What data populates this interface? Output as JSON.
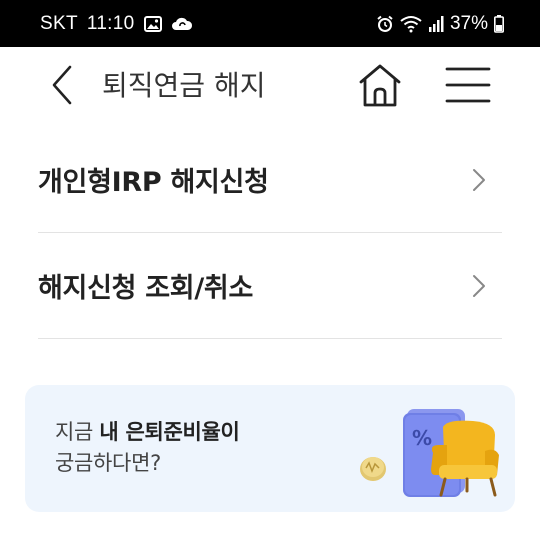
{
  "status_bar": {
    "carrier": "SKT",
    "time": "11:10",
    "battery": "37%",
    "icons": [
      "gallery-icon",
      "cloud-sync-icon",
      "alarm-icon",
      "wifi-icon",
      "signal-icon",
      "battery-icon"
    ]
  },
  "header": {
    "title": "퇴직연금 해지",
    "back_icon": "chevron-left-icon",
    "home_icon": "home-icon",
    "menu_icon": "hamburger-menu-icon"
  },
  "menu": {
    "items": [
      {
        "label": "개인형IRP 해지신청"
      },
      {
        "label": "해지신청 조회/취소"
      }
    ]
  },
  "banner": {
    "line1_prefix": "지금 ",
    "line1_bold": "내 은퇴준비율이",
    "line2": "궁금하다면?",
    "illustration": "chair-percent-card-illustration",
    "colors": {
      "background": "#eef5fd",
      "chair": "#f3b61f",
      "card": "#6f7fe6"
    }
  }
}
